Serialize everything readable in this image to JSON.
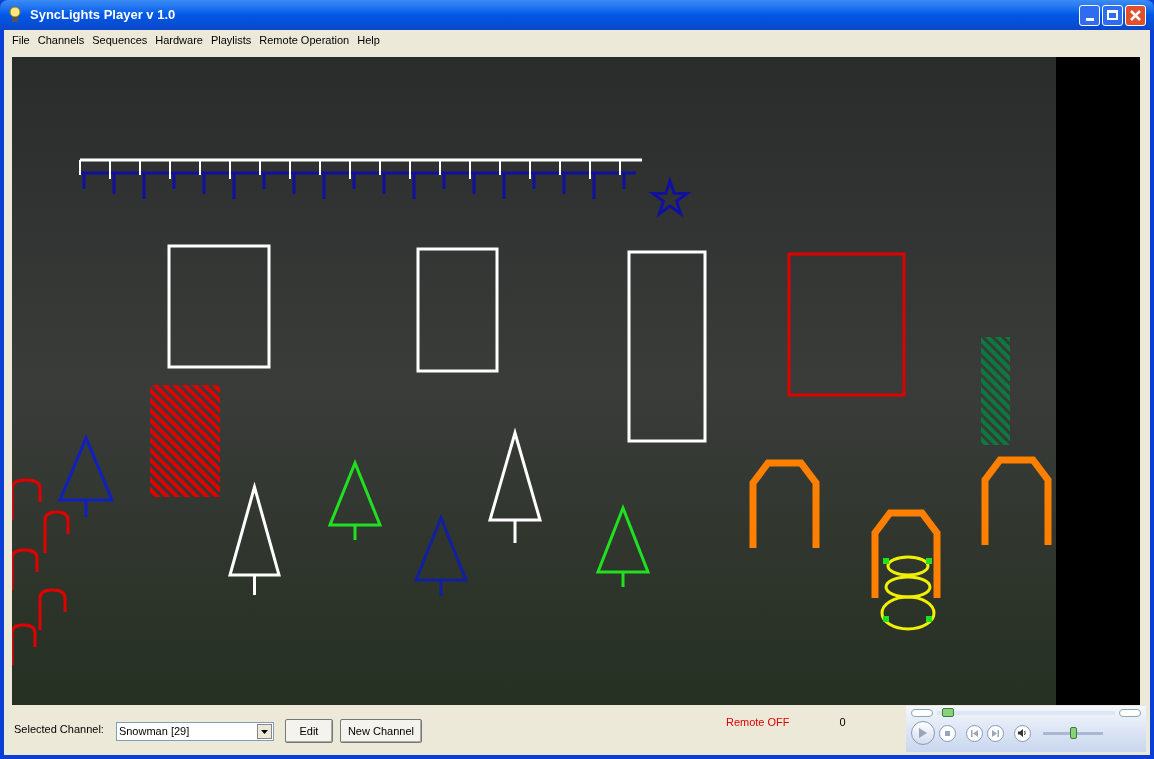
{
  "window": {
    "title": "SyncLights Player v 1.0"
  },
  "menu": [
    "File",
    "Channels",
    "Sequences",
    "Hardware",
    "Playlists",
    "Remote Operation",
    "Help"
  ],
  "channel_bar": {
    "label": "Selected Channel:",
    "selected_channel": "Snowman [29]",
    "buttons": [
      "Edit",
      "New Channel"
    ]
  },
  "status": {
    "remote": "Remote OFF",
    "counter": "0"
  },
  "player": {
    "seek": {
      "level": 0.03
    },
    "volume": {
      "level": 0.5
    }
  }
}
